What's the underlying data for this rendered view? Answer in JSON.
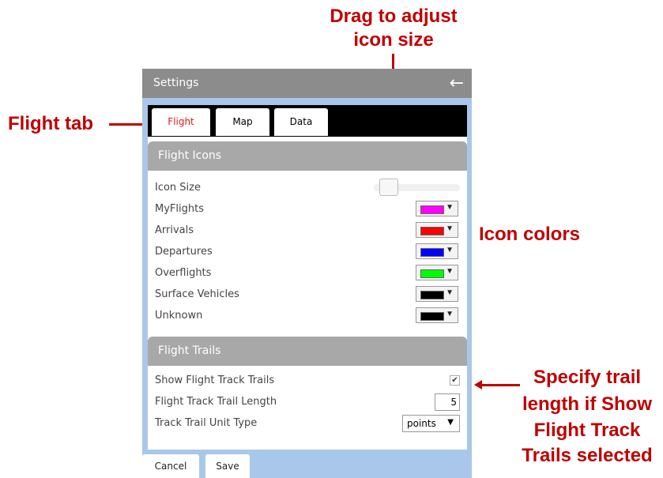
{
  "annotations": {
    "drag_line1": "Drag to adjust",
    "drag_line2": "icon size",
    "flight_tab": "Flight tab",
    "icon_colors": "Icon colors",
    "trail_line1": "Specify trail",
    "trail_line2": "length if Show",
    "trail_line3": "Flight Track",
    "trail_line4": "Trails selected"
  },
  "settings": {
    "title": "Settings",
    "back_icon": "back-arrow-icon",
    "tabs": [
      {
        "label": "Flight",
        "active": true
      },
      {
        "label": "Map",
        "active": false
      },
      {
        "label": "Data",
        "active": false
      }
    ],
    "flight_icons": {
      "header": "Flight Icons",
      "icon_size_label": "Icon Size",
      "rows": [
        {
          "label": "MyFlights",
          "color": "#ff00ff"
        },
        {
          "label": "Arrivals",
          "color": "#ff0000"
        },
        {
          "label": "Departures",
          "color": "#0000ff"
        },
        {
          "label": "Overflights",
          "color": "#00ff00"
        },
        {
          "label": "Surface Vehicles",
          "color": "#000000"
        },
        {
          "label": "Unknown",
          "color": "#000000"
        }
      ]
    },
    "flight_trails": {
      "header": "Flight Trails",
      "show_label": "Show Flight Track Trails",
      "show_checked": true,
      "length_label": "Flight Track Trail Length",
      "length_value": "5",
      "unit_label": "Track Trail Unit Type",
      "unit_value": "points"
    },
    "footer": {
      "cancel": "Cancel",
      "save": "Save"
    }
  },
  "colors": {
    "annotation": "#c00000",
    "panel_bg": "#a9c7ea",
    "header_gray": "#a8a8a8",
    "active_tab": "#e21a1a"
  }
}
